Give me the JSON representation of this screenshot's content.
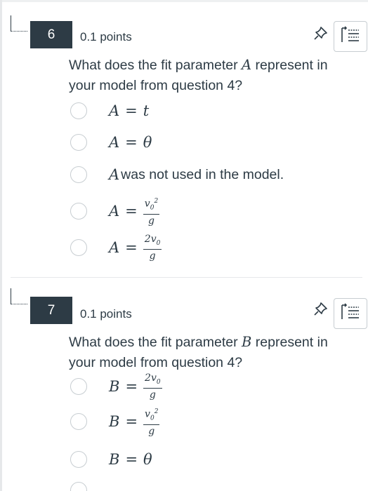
{
  "questions": [
    {
      "number": "6",
      "points": "0.1 points",
      "text_before": "What does the fit parameter ",
      "variable": "A",
      "text_after": " represent in your model from question 4?",
      "answers": [
        {
          "var": "A",
          "op": "=",
          "rhs": "t"
        },
        {
          "var": "A",
          "op": "=",
          "rhs": "θ"
        },
        {
          "var": "A",
          "text": "was not used in the model."
        },
        {
          "var": "A",
          "op": "=",
          "num": "v",
          "num_sub": "0",
          "num_sup": "2",
          "den": "g"
        },
        {
          "var": "A",
          "op": "=",
          "num": "2v",
          "num_sub": "0",
          "den": "g"
        }
      ]
    },
    {
      "number": "7",
      "points": "0.1 points",
      "text_before": "What does the fit parameter ",
      "variable": "B",
      "text_after": " represent in your model from question 4?",
      "answers": [
        {
          "var": "B",
          "op": "=",
          "num": "2v",
          "num_sub": "0",
          "den": "g"
        },
        {
          "var": "B",
          "op": "=",
          "num": "v",
          "num_sub": "0",
          "num_sup": "2",
          "den": "g"
        },
        {
          "var": "B",
          "op": "=",
          "rhs": "θ"
        }
      ]
    }
  ],
  "icons": {
    "pin": "pin-icon",
    "list": "list-icon"
  },
  "colors": {
    "badge_bg": "#2d3b45",
    "text": "#2d3b45",
    "border": "#c7cdd1"
  }
}
